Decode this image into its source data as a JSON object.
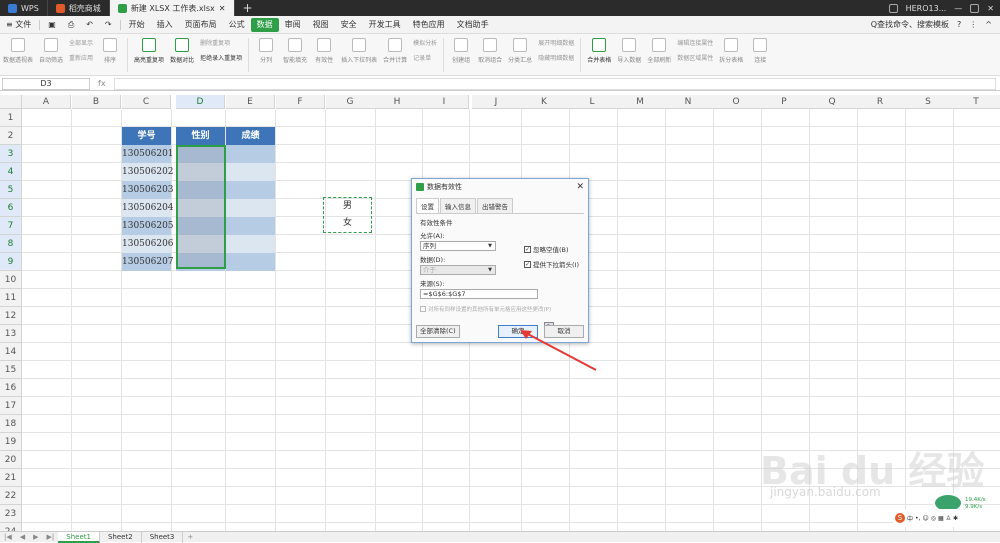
{
  "titlebar": {
    "tabs": [
      {
        "label": "WPS",
        "icon": "wps-logo-icon",
        "color": "#3a7bd5"
      },
      {
        "label": "稻壳商城",
        "icon": "docer-icon",
        "color": "#e05a2b"
      },
      {
        "label": "新建 XLSX 工作表.xlsx",
        "icon": "spreadsheet-icon",
        "color": "#2e9e47"
      }
    ],
    "new_tab": "+",
    "user": "HERO13..."
  },
  "menubar": {
    "file_label": "≡ 文件",
    "items": [
      "开始",
      "插入",
      "页面布局",
      "公式",
      "数据",
      "审阅",
      "视图",
      "安全",
      "开发工具",
      "特色应用",
      "文档助手"
    ],
    "active": "数据",
    "search": "Q查找命令、搜索模板"
  },
  "ribbon": {
    "buttons": [
      {
        "label": "数据透视表",
        "enabled": false
      },
      {
        "label": "自动筛选",
        "enabled": false
      },
      {
        "label": "排序",
        "enabled": false
      },
      {
        "label": "高亮重复项",
        "enabled": true
      },
      {
        "label": "数据对比",
        "enabled": true
      },
      {
        "label": "分列",
        "enabled": false
      },
      {
        "label": "智能填充",
        "enabled": false
      },
      {
        "label": "有效性",
        "enabled": false
      },
      {
        "label": "插入下拉列表",
        "enabled": false
      },
      {
        "label": "合并计算",
        "enabled": false
      },
      {
        "label": "记录单",
        "enabled": false
      },
      {
        "label": "创建组",
        "enabled": false
      },
      {
        "label": "取消组合",
        "enabled": false
      },
      {
        "label": "分类汇总",
        "enabled": false
      },
      {
        "label": "合并表格",
        "enabled": true
      },
      {
        "label": "导入数据",
        "enabled": false
      },
      {
        "label": "全部刷新",
        "enabled": false
      },
      {
        "label": "数据区域属性",
        "enabled": false
      },
      {
        "label": "拆分表格",
        "enabled": false
      },
      {
        "label": "连接",
        "enabled": false
      }
    ],
    "small_a": [
      "全部显示",
      "重新应用"
    ],
    "small_b": [
      "删除重复项",
      "拒绝录入重复项"
    ],
    "small_c": [
      "模拟分析",
      "展开明细数据",
      "隐藏明细数据"
    ],
    "small_d": [
      "编辑连接属性"
    ]
  },
  "formula": {
    "cell_ref": "D3",
    "fx": "fx",
    "value": ""
  },
  "grid": {
    "columns": [
      "A",
      "B",
      "C",
      "D",
      "E",
      "F",
      "G",
      "H",
      "I",
      "J",
      "K",
      "L",
      "M",
      "N",
      "O",
      "P",
      "Q",
      "R",
      "S",
      "T"
    ],
    "rows": [
      "1",
      "2",
      "3",
      "4",
      "5",
      "6",
      "7",
      "8",
      "9",
      "10",
      "11",
      "12",
      "13",
      "14",
      "15",
      "16",
      "17",
      "18",
      "19",
      "20",
      "21",
      "22",
      "23",
      "24"
    ],
    "selected_column": "D",
    "header_color": "#3d75b8",
    "table_headers": [
      "学号",
      "性别",
      "成绩"
    ],
    "student_ids": [
      "130506201",
      "130506202",
      "130506203",
      "130506204",
      "130506205",
      "130506206",
      "130506207"
    ],
    "source_values": [
      "男",
      "女"
    ]
  },
  "dialog": {
    "title": "数据有效性",
    "close": "✕",
    "tabs": [
      "设置",
      "输入信息",
      "出错警告"
    ],
    "section": "有效性条件",
    "allow_label": "允许(A):",
    "allow_value": "序列",
    "data_label": "数据(D):",
    "data_value": "介于",
    "ignore_blank": "忽略空值(B)",
    "dropdown_arrow": "提供下拉箭头(I)",
    "source_label": "来源(S):",
    "source_value": "=$G$6:$G$7",
    "apply_all": "对所有同样设置的其他所有单元格应用这些更改(P)",
    "clear_all": "全部清除(C)",
    "ok": "确定",
    "cancel": "取消"
  },
  "sheets": {
    "tabs": [
      "Sheet1",
      "Sheet2",
      "Sheet3"
    ],
    "active": "Sheet1"
  },
  "watermark": {
    "line1": "Bai du 经验",
    "line2": "jingyan.baidu.com"
  },
  "tray": {
    "speed_up": "19.4K/s",
    "speed_down": "9.9K/s",
    "ime": "中"
  }
}
